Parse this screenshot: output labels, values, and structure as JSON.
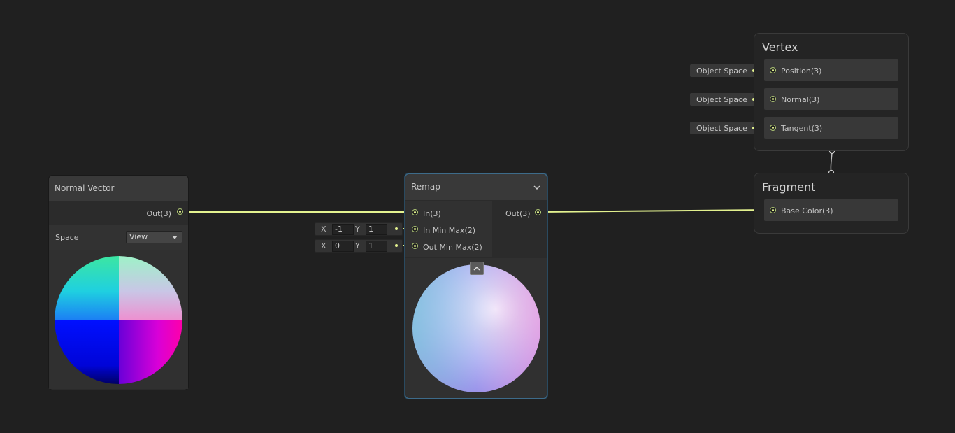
{
  "nodes": {
    "normal_vector": {
      "title": "Normal Vector",
      "output_label": "Out(3)",
      "space_label": "Space",
      "space_value": "View"
    },
    "remap": {
      "title": "Remap",
      "inputs": [
        {
          "label": "In(3)"
        },
        {
          "label": "In Min Max(2)",
          "x_label": "X",
          "x_value": "-1",
          "y_label": "Y",
          "y_value": "1"
        },
        {
          "label": "Out Min Max(2)",
          "x_label": "X",
          "x_value": "0",
          "y_label": "Y",
          "y_value": "1"
        }
      ],
      "output_label": "Out(3)"
    }
  },
  "master": {
    "vertex": {
      "title": "Vertex",
      "slots": [
        {
          "label": "Position(3)",
          "tag": "Object Space"
        },
        {
          "label": "Normal(3)",
          "tag": "Object Space"
        },
        {
          "label": "Tangent(3)",
          "tag": "Object Space"
        }
      ]
    },
    "fragment": {
      "title": "Fragment",
      "slots": [
        {
          "label": "Base Color(3)"
        }
      ]
    }
  },
  "colors": {
    "wire": "#e3f28f",
    "background": "#202020",
    "node": "#2b2b2b",
    "selected_border": "#3d6b8a"
  }
}
